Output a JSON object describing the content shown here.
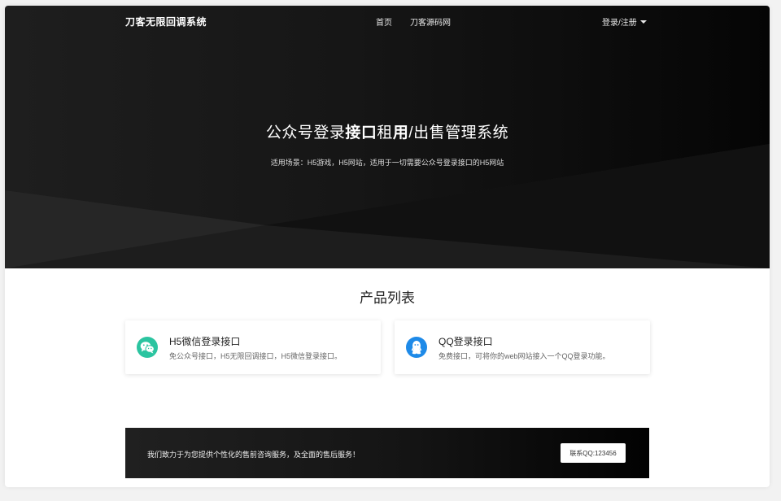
{
  "nav": {
    "brand": "刀客无限回调系统",
    "links": [
      {
        "label": "首页"
      },
      {
        "label": "刀客源码网"
      }
    ],
    "user_menu_label": "登录/注册"
  },
  "hero": {
    "title_part1": "公众号登录",
    "title_bold1": "接口",
    "title_part2": "租",
    "title_bold2": "用",
    "title_part3": "/出售管理系统",
    "subtitle": "适用场景：H5游戏，H5网站，适用于一切需要公众号登录接口的H5网站"
  },
  "products": {
    "section_title": "产品列表",
    "items": [
      {
        "title": "H5微信登录接口",
        "desc": "免公众号接口，H5无限回调接口，H5微信登录接口。",
        "icon": "wechat-icon",
        "color": "#2bc4a0"
      },
      {
        "title": "QQ登录接口",
        "desc": "免费接口，可将你的web网站接入一个QQ登录功能。",
        "icon": "qq-icon",
        "color": "#1e8ae8"
      }
    ]
  },
  "banner": {
    "text": "我们致力于为您提供个性化的售前咨询服务，及全面的售后服务！",
    "button_label": "联系QQ:123456"
  }
}
